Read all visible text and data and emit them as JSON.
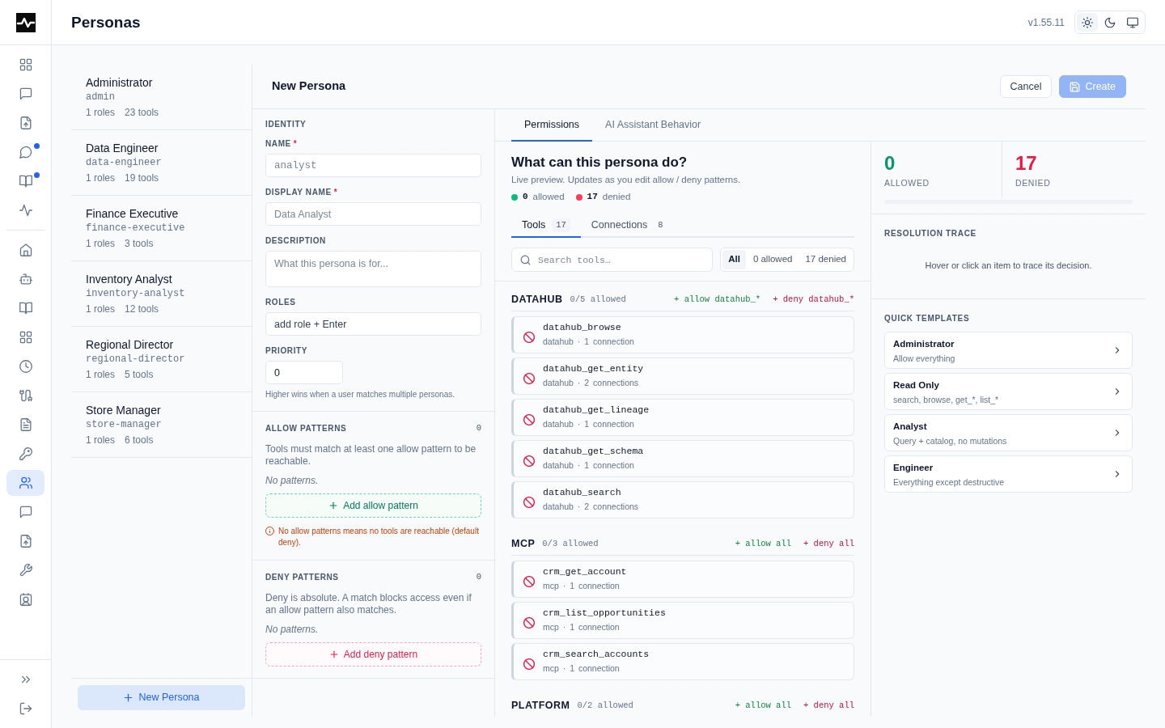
{
  "page": {
    "title": "Personas"
  },
  "app": {
    "version": "v1.55.11",
    "theme_options": [
      {
        "selected": true
      },
      {
        "selected": false
      },
      {
        "selected": false
      }
    ]
  },
  "nav_rail": {
    "primary": [
      {
        "selected": false,
        "unread": false
      },
      {
        "selected": false,
        "unread": false
      },
      {
        "selected": false,
        "unread": false
      },
      {
        "selected": false,
        "unread": true
      },
      {
        "selected": false,
        "unread": true
      },
      {
        "selected": false,
        "unread": false
      }
    ],
    "secondary": [
      {
        "selected": false,
        "unread": false
      },
      {
        "selected": false,
        "unread": false
      },
      {
        "selected": false,
        "unread": false
      },
      {
        "selected": false,
        "unread": false
      },
      {
        "selected": false,
        "unread": false
      },
      {
        "selected": false,
        "unread": false
      },
      {
        "selected": false,
        "unread": false
      },
      {
        "selected": false,
        "unread": false
      },
      {
        "selected": true,
        "unread": false
      },
      {
        "selected": false,
        "unread": false
      },
      {
        "selected": false,
        "unread": false
      },
      {
        "selected": false,
        "unread": false
      },
      {
        "selected": false,
        "unread": false
      }
    ]
  },
  "personas": {
    "items": [
      {
        "name": "Administrator",
        "slug": "admin",
        "roles": "1 roles",
        "tools": "23 tools",
        "selected": false
      },
      {
        "name": "Data Engineer",
        "slug": "data-engineer",
        "roles": "1 roles",
        "tools": "19 tools",
        "selected": false
      },
      {
        "name": "Finance Executive",
        "slug": "finance-executive",
        "roles": "1 roles",
        "tools": "3 tools",
        "selected": false
      },
      {
        "name": "Inventory Analyst",
        "slug": "inventory-analyst",
        "roles": "1 roles",
        "tools": "12 tools",
        "selected": false
      },
      {
        "name": "Regional Director",
        "slug": "regional-director",
        "roles": "1 roles",
        "tools": "5 tools",
        "selected": false
      },
      {
        "name": "Store Manager",
        "slug": "store-manager",
        "roles": "1 roles",
        "tools": "6 tools",
        "selected": false
      }
    ],
    "new_button": "New Persona"
  },
  "editor": {
    "title": "New Persona",
    "actions": [
      {
        "kind": "cancel",
        "label": "Cancel",
        "disabled": false
      },
      {
        "kind": "create",
        "label": "Create",
        "disabled": true
      }
    ],
    "identity": {
      "heading": "IDENTITY",
      "fields": [
        {
          "kind": "slug",
          "label": "NAME",
          "marker": "*",
          "placeholder": "analyst"
        },
        {
          "kind": "text",
          "label": "DISPLAY NAME",
          "marker": "*",
          "placeholder": "Data Analyst"
        },
        {
          "kind": "textarea",
          "label": "DESCRIPTION",
          "placeholder": "What this persona is for..."
        },
        {
          "kind": "tags",
          "label": "ROLES",
          "placeholder": "add role + Enter"
        },
        {
          "kind": "number",
          "label": "PRIORITY",
          "value": "0",
          "hint": "Higher wins when a user matches multiple personas."
        }
      ]
    },
    "pattern_sections": [
      {
        "kind": "allow",
        "heading": "ALLOW PATTERNS",
        "count": "0",
        "description": "Tools must match at least one allow pattern to be reachable.",
        "empty": "No patterns.",
        "add_label": "Add allow pattern",
        "warning": "No allow patterns means no tools are reachable (default deny)."
      },
      {
        "kind": "deny",
        "heading": "DENY PATTERNS",
        "count": "0",
        "description": "Deny is absolute. A match blocks access even if an allow pattern also matches.",
        "empty": "No patterns.",
        "add_label": "Add deny pattern"
      }
    ],
    "tabs": [
      {
        "label": "Permissions",
        "selected": true
      },
      {
        "label": "AI Assistant Behavior",
        "selected": false
      }
    ],
    "preview": {
      "heading": "What can this persona do?",
      "subtitle": "Live preview. Updates as you edit allow / deny patterns.",
      "legend": [
        {
          "kind": "allowed",
          "count": "0",
          "label": "allowed"
        },
        {
          "kind": "denied",
          "count": "17",
          "label": "denied"
        }
      ],
      "subtabs": [
        {
          "label": "Tools",
          "count": "17",
          "selected": true
        },
        {
          "label": "Connections",
          "count": "8",
          "selected": false
        }
      ],
      "search": {
        "placeholder": "Search tools…"
      },
      "filters": [
        {
          "label": "All",
          "selected": true
        },
        {
          "label": "0 allowed",
          "selected": false
        },
        {
          "label": "17 denied",
          "selected": false
        }
      ],
      "groups": [
        {
          "name": "DATAHUB",
          "summary": "0/5 allowed",
          "allow_action": "+ allow datahub_*",
          "deny_action": "+ deny datahub_*",
          "tools": [
            {
              "name": "datahub_browse",
              "meta": "datahub · 1 connection",
              "allowed": false
            },
            {
              "name": "datahub_get_entity",
              "meta": "datahub · 2 connections",
              "allowed": false
            },
            {
              "name": "datahub_get_lineage",
              "meta": "datahub · 1 connection",
              "allowed": false
            },
            {
              "name": "datahub_get_schema",
              "meta": "datahub · 1 connection",
              "allowed": false
            },
            {
              "name": "datahub_search",
              "meta": "datahub · 2 connections",
              "allowed": false
            }
          ]
        },
        {
          "name": "MCP",
          "summary": "0/3 allowed",
          "allow_action": "+ allow all",
          "deny_action": "+ deny all",
          "tools": [
            {
              "name": "crm_get_account",
              "meta": "mcp · 1 connection",
              "allowed": false
            },
            {
              "name": "crm_list_opportunities",
              "meta": "mcp · 1 connection",
              "allowed": false
            },
            {
              "name": "crm_search_accounts",
              "meta": "mcp · 1 connection",
              "allowed": false
            }
          ]
        },
        {
          "name": "PLATFORM",
          "summary": "0/2 allowed",
          "allow_action": "+ allow all",
          "deny_action": "+ deny all"
        }
      ]
    },
    "summary": {
      "stats": [
        {
          "kind": "allowed",
          "value": "0",
          "label": "ALLOWED"
        },
        {
          "kind": "denied",
          "value": "17",
          "label": "DENIED"
        }
      ],
      "level": 0
    },
    "trace": {
      "heading": "RESOLUTION TRACE",
      "empty": "Hover or click an item to trace its decision."
    },
    "templates": {
      "heading": "QUICK TEMPLATES",
      "items": [
        {
          "name": "Administrator",
          "description": "Allow everything"
        },
        {
          "name": "Read Only",
          "description": "search, browse, get_*, list_*"
        },
        {
          "name": "Analyst",
          "description": "Query + catalog, no mutations"
        },
        {
          "name": "Engineer",
          "description": "Everything except destructive"
        }
      ]
    }
  }
}
